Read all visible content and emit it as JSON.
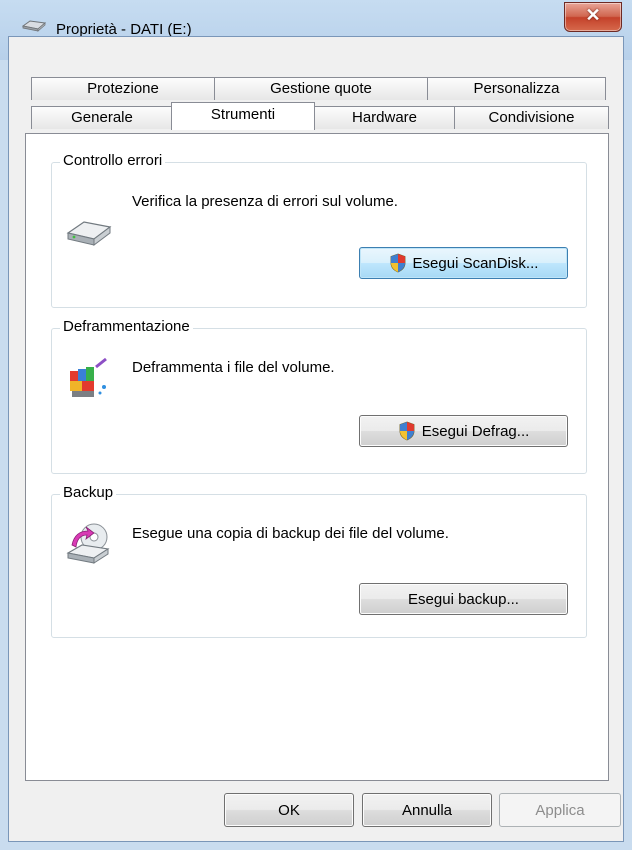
{
  "window": {
    "title": "Proprietà - DATI (E:)"
  },
  "tabs": {
    "row1": [
      "Protezione",
      "Gestione quote",
      "Personalizza"
    ],
    "row2": [
      "Generale",
      "Strumenti",
      "Hardware",
      "Condivisione"
    ],
    "active": "Strumenti"
  },
  "groups": {
    "error_check": {
      "label": "Controllo errori",
      "description": "Verifica la presenza di errori sul volume.",
      "button": "Esegui ScanDisk...",
      "icon": "hard-drive-icon"
    },
    "defrag": {
      "label": "Deframmentazione",
      "description": "Deframmenta i file del volume.",
      "button": "Esegui Defrag...",
      "icon": "defrag-icon"
    },
    "backup": {
      "label": "Backup",
      "description": "Esegue una copia di backup dei file del volume.",
      "button": "Esegui backup...",
      "icon": "backup-icon"
    }
  },
  "footer": {
    "ok": "OK",
    "cancel": "Annulla",
    "apply": "Applica"
  },
  "colors": {
    "close_button": "#c4412a",
    "tab_border": "#898c95",
    "group_border": "#d5dfe5"
  }
}
